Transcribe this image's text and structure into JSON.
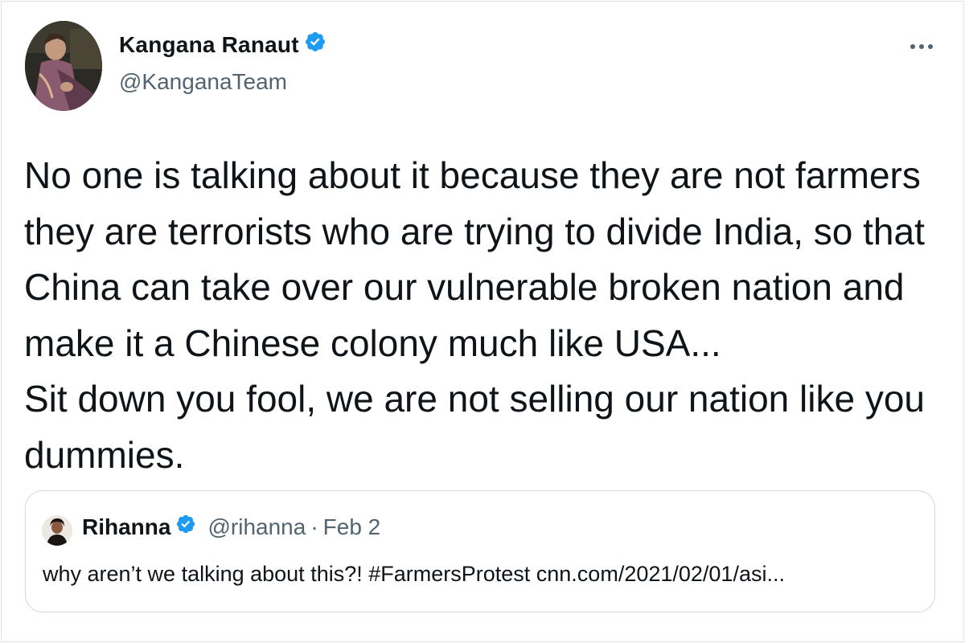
{
  "tweet": {
    "author": {
      "display_name": "Kangana Ranaut",
      "handle": "@KanganaTeam",
      "verified": true
    },
    "more_icon": "more-horizontal-icon",
    "text_lines": [
      "No one is talking about it because they are not farmers",
      "they are terrorists who are trying to divide India, so that",
      "China can take over our vulnerable broken nation and",
      "make it a Chinese colony much like USA...",
      "Sit down you fool, we are not selling our nation like you",
      "dummies."
    ]
  },
  "quoted_tweet": {
    "display_name": "Rihanna",
    "handle": "@rihanna",
    "separator": "·",
    "date": "Feb 2",
    "verified": true,
    "text": "why aren’t we talking about this?! #FarmersProtest cnn.com/2021/02/01/asi..."
  },
  "colors": {
    "verified_badge": "#1d9bf0",
    "text_primary": "#0f1419",
    "text_secondary": "#536471",
    "border": "#cfd9de"
  }
}
